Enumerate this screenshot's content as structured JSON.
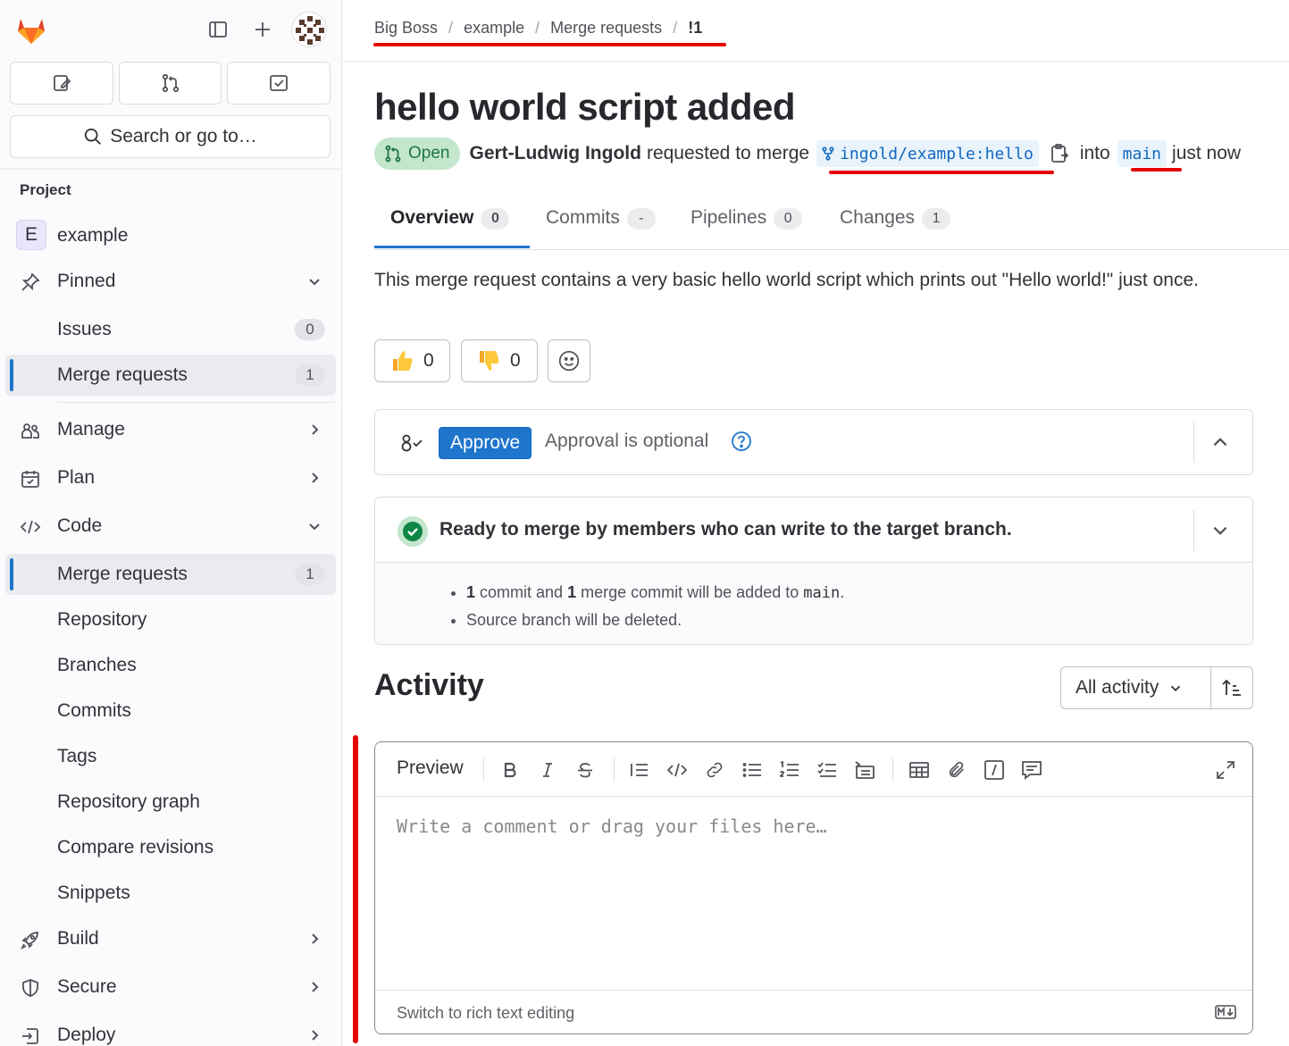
{
  "sidebar": {
    "search_label": "Search or go to…",
    "section_label": "Project",
    "project": {
      "initial": "E",
      "name": "example"
    },
    "pinned": "Pinned",
    "issues": {
      "label": "Issues",
      "count": "0"
    },
    "pinned_mr": {
      "label": "Merge requests",
      "count": "1"
    },
    "manage": "Manage",
    "plan": "Plan",
    "code": "Code",
    "code_items": {
      "merge_requests": {
        "label": "Merge requests",
        "count": "1"
      },
      "repository": "Repository",
      "branches": "Branches",
      "commits": "Commits",
      "tags": "Tags",
      "repository_graph": "Repository graph",
      "compare_revisions": "Compare revisions",
      "snippets": "Snippets"
    },
    "build": "Build",
    "secure": "Secure",
    "deploy": "Deploy"
  },
  "breadcrumb": [
    "Big Boss",
    "example",
    "Merge requests",
    "!1"
  ],
  "mr": {
    "title": "hello world script added",
    "status": "Open",
    "author": "Gert-Ludwig Ingold",
    "requested_text": "requested to merge",
    "source_branch": "ingold/example:hello",
    "into_text": "into",
    "target_branch": "main",
    "time": "just now"
  },
  "tabs": [
    {
      "label": "Overview",
      "count": "0"
    },
    {
      "label": "Commits",
      "count": "-"
    },
    {
      "label": "Pipelines",
      "count": "0"
    },
    {
      "label": "Changes",
      "count": "1"
    }
  ],
  "description": "This merge request contains a very basic hello world script which prints out \"Hello world!\" just once.",
  "reactions": {
    "thumbs_up": "0",
    "thumbs_down": "0"
  },
  "approval": {
    "button": "Approve",
    "text": "Approval is optional"
  },
  "merge": {
    "title": "Ready to merge by members who can write to the target branch.",
    "line1": {
      "n1": "1",
      "t1": "commit and",
      "n2": "1",
      "t2": "merge commit will be added to",
      "branch": "main",
      "end": "."
    },
    "line2": "Source branch will be deleted."
  },
  "activity": {
    "title": "Activity",
    "filter": "All activity"
  },
  "editor": {
    "preview_tab": "Preview",
    "placeholder": "Write a comment or drag your files here…",
    "switch_link": "Switch to rich text editing"
  },
  "colors": {
    "accent": "#1f75cb",
    "annotation_red": "#e60000",
    "open_badge_bg": "#c3e6cd",
    "open_badge_text": "#217645"
  }
}
